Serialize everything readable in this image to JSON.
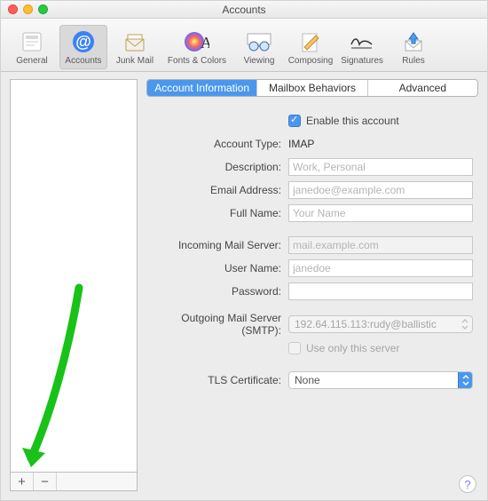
{
  "window": {
    "title": "Accounts"
  },
  "toolbar": {
    "items": [
      {
        "label": "General"
      },
      {
        "label": "Accounts"
      },
      {
        "label": "Junk Mail"
      },
      {
        "label": "Fonts & Colors"
      },
      {
        "label": "Viewing"
      },
      {
        "label": "Composing"
      },
      {
        "label": "Signatures"
      },
      {
        "label": "Rules"
      }
    ]
  },
  "segment": {
    "items": [
      "Account Information",
      "Mailbox Behaviors",
      "Advanced"
    ]
  },
  "form": {
    "enable_label": "Enable this account",
    "account_type_label": "Account Type:",
    "account_type_value": "IMAP",
    "description_label": "Description:",
    "description_placeholder": "Work, Personal",
    "email_label": "Email Address:",
    "email_placeholder": "janedoe@example.com",
    "fullname_label": "Full Name:",
    "fullname_placeholder": "Your Name",
    "incoming_label": "Incoming Mail Server:",
    "incoming_placeholder": "mail.example.com",
    "username_label": "User Name:",
    "username_placeholder": "janedoe",
    "password_label": "Password:",
    "smtp_label": "Outgoing Mail Server (SMTP):",
    "smtp_value": "192.64.115.113:rudy@ballistic",
    "use_only_label": "Use only this server",
    "tls_label": "TLS Certificate:",
    "tls_value": "None"
  },
  "colors": {
    "accent": "#4a97ee"
  }
}
